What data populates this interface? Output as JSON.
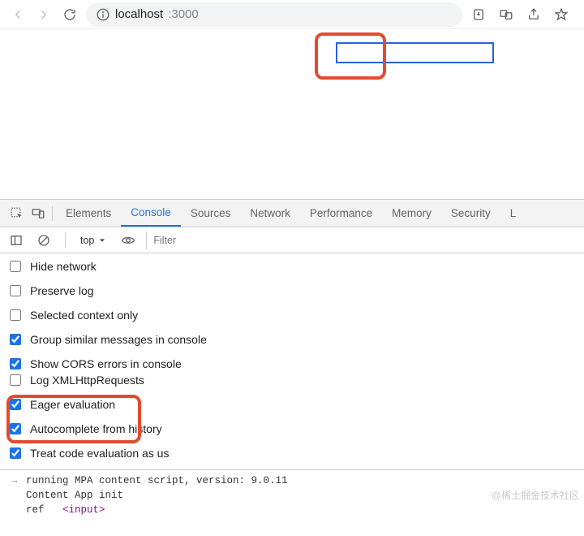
{
  "addressBar": {
    "host": "localhost",
    "port": ":3000"
  },
  "devtools": {
    "tabs": [
      "Elements",
      "Console",
      "Sources",
      "Network",
      "Performance",
      "Memory",
      "Security",
      "L"
    ],
    "activeTab": "Console",
    "context": "top",
    "filterPlaceholder": "Filter",
    "optionsLeft": [
      {
        "label": "Hide network",
        "checked": false
      },
      {
        "label": "Preserve log",
        "checked": false
      },
      {
        "label": "Selected context only",
        "checked": false
      },
      {
        "label": "Group similar messages in console",
        "checked": true
      },
      {
        "label": "Show CORS errors in console",
        "checked": true
      }
    ],
    "optionsRight": [
      {
        "label": "Log XMLHttpRequests",
        "checked": false
      },
      {
        "label": "Eager evaluation",
        "checked": true
      },
      {
        "label": "Autocomplete from history",
        "checked": true
      },
      {
        "label": "Treat code evaluation as us",
        "checked": true
      }
    ],
    "logs": {
      "line1": "running MPA content script, version: 9.0.11",
      "line2": "Content App init",
      "line3_prefix": "ref   ",
      "line3_tag": "<input>"
    }
  },
  "watermark": "@稀土掘金技术社区"
}
